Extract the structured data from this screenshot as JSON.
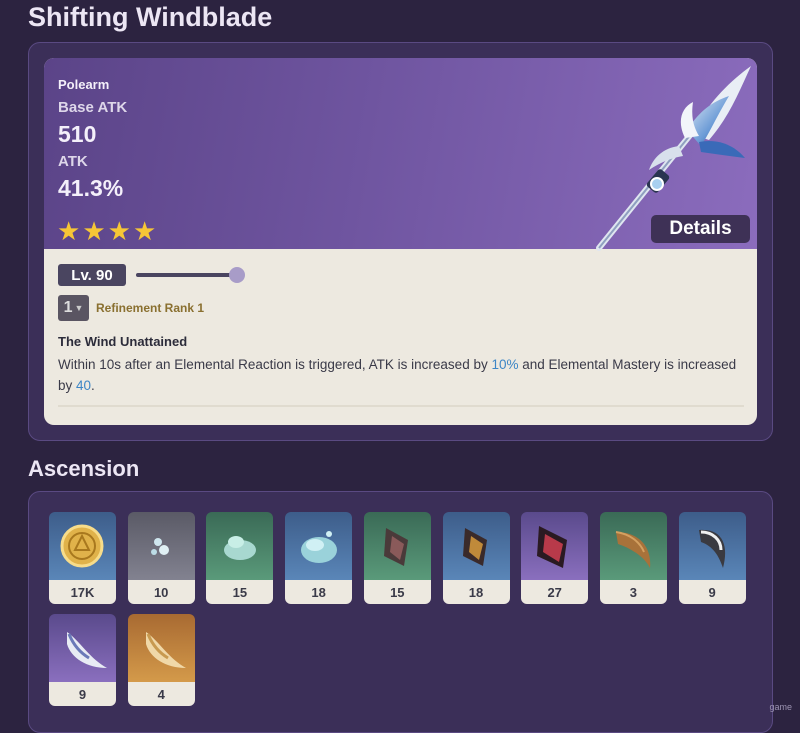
{
  "weapon": {
    "name": "Shifting Windblade",
    "type": "Polearm",
    "base_atk_label": "Base ATK",
    "base_atk_value": "510",
    "substat_label": "ATK",
    "substat_value": "41.3%",
    "rarity_stars": 4,
    "details_label": "Details",
    "level_label": "Lv. 90",
    "level_fraction": 1.0,
    "refinement_value": "1",
    "refinement_label": "Refinement Rank 1",
    "passive_name": "The Wind Unattained",
    "passive_desc_part1": "Within 10s after an Elemental Reaction is triggered, ATK is increased by ",
    "passive_value1": "10%",
    "passive_desc_part2": " and Elemental Mastery is increased by ",
    "passive_value2": "40",
    "passive_desc_part3": "."
  },
  "ascension": {
    "title": "Ascension",
    "items": [
      {
        "icon": "mora-coin-icon",
        "rarity": "r3",
        "count": "17K"
      },
      {
        "icon": "slime-condensate-icon",
        "rarity": "r1",
        "count": "10"
      },
      {
        "icon": "slime-secretions-icon",
        "rarity": "r2",
        "count": "15"
      },
      {
        "icon": "slime-concentrate-icon",
        "rarity": "r3",
        "count": "18"
      },
      {
        "icon": "fragment-green-icon",
        "rarity": "r2",
        "count": "15"
      },
      {
        "icon": "fragment-blue-icon",
        "rarity": "r3",
        "count": "18"
      },
      {
        "icon": "fragment-purple-icon",
        "rarity": "r4",
        "count": "27"
      },
      {
        "icon": "horn-green-icon",
        "rarity": "r2",
        "count": "3"
      },
      {
        "icon": "horn-blue-icon",
        "rarity": "r3",
        "count": "9"
      },
      {
        "icon": "horn-purple-icon",
        "rarity": "r4",
        "count": "9"
      },
      {
        "icon": "horn-gold-icon",
        "rarity": "r5",
        "count": "4"
      }
    ]
  },
  "colors": {
    "background": "#2c2340",
    "panel": "#3b2f58",
    "star": "#f6c636",
    "highlight": "#3d86c6"
  },
  "watermark": "game"
}
